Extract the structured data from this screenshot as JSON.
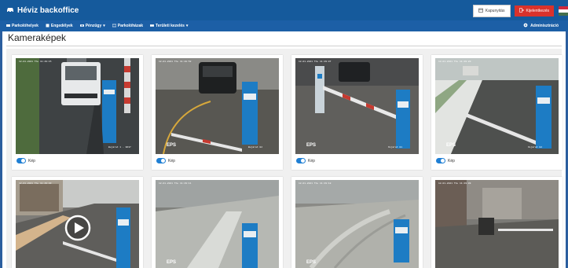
{
  "app": {
    "title": "Héviz backoffice",
    "colors": {
      "header": "#155a9c",
      "nav": "#1c5fa6",
      "accent": "#1f7fd4",
      "danger": "#d9322b"
    }
  },
  "header": {
    "buttons": [
      {
        "label": "Kapunyitás",
        "icon": "calendar-icon"
      },
      {
        "label": "Kijelentkezés",
        "icon": "logout-icon"
      }
    ],
    "flag": "hungary-flag-icon"
  },
  "nav": {
    "items": [
      {
        "label": "Parkolóhelyek",
        "icon": "parking-icon"
      },
      {
        "label": "Engedélyek",
        "icon": "permit-icon"
      },
      {
        "label": "Pénzügy",
        "icon": "money-icon",
        "dropdown": true
      },
      {
        "label": "Parkolóházak",
        "icon": "id-card-icon"
      },
      {
        "label": "Területi kezelés",
        "icon": "area-icon",
        "dropdown": true
      }
    ],
    "admin": {
      "label": "Adminisztráció",
      "icon": "gear-icon"
    }
  },
  "page": {
    "title": "Kameraképek"
  },
  "cameras": [
    {
      "toggle_label": "Kép",
      "timestamp": "12-01-2021 Thu 11:49:15",
      "caption": "Bejárat 1 - 9637",
      "eps": "",
      "toggle_on": true
    },
    {
      "toggle_label": "Kép",
      "timestamp": "12-01-2021 Thu 11:48:52",
      "caption": "Bejárat 02",
      "eps": "EPS",
      "toggle_on": true
    },
    {
      "toggle_label": "Kép",
      "timestamp": "12-01-2021 Thu 11:49:07",
      "caption": "Kijárat 01",
      "eps": "EPS",
      "toggle_on": true
    },
    {
      "toggle_label": "Kép",
      "timestamp": "12-01-2021 Thu 11:49:20",
      "caption": "Kijárat 02",
      "eps": "EPS",
      "toggle_on": true
    },
    {
      "toggle_label": "",
      "timestamp": "12-01-2021 Thu 11:49:03",
      "caption": "",
      "eps": "",
      "toggle_on": true
    },
    {
      "toggle_label": "",
      "timestamp": "12-01-2021 Thu 11:49:11",
      "caption": "",
      "eps": "EPS",
      "toggle_on": true
    },
    {
      "toggle_label": "",
      "timestamp": "12-01-2021 Thu 11:49:18",
      "caption": "",
      "eps": "EPS",
      "toggle_on": true
    },
    {
      "toggle_label": "",
      "timestamp": "12-01-2021 Thu 11:49:09",
      "caption": "",
      "eps": "",
      "toggle_on": true
    }
  ]
}
